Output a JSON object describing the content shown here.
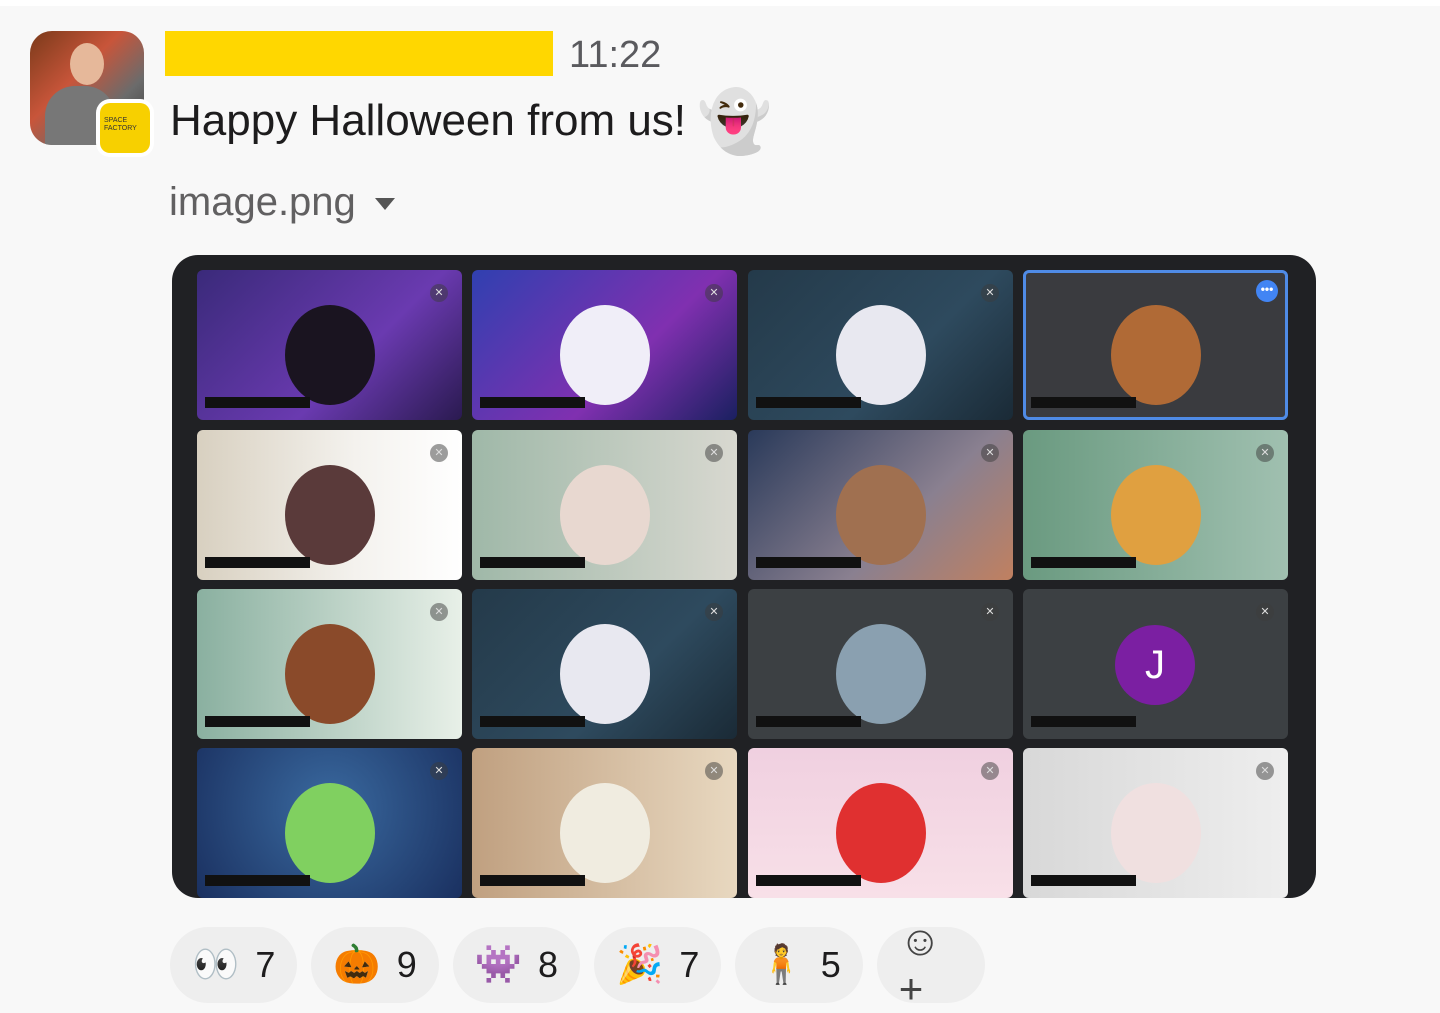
{
  "message": {
    "timestamp": "11:22",
    "text": "Happy Halloween from us!",
    "emoji": "👻",
    "badge_text": "SPACE FACTORY"
  },
  "attachment": {
    "filename": "image.png"
  },
  "video_grid": {
    "tiles": [
      {
        "bg": "linear-gradient(135deg,#3a2a7a,#6a3ab0 60%,#2a1a50)",
        "fig": "#1a1420"
      },
      {
        "bg": "linear-gradient(135deg,#3040b0,#8030b0 60%,#1a2060)",
        "fig": "#f0eef8"
      },
      {
        "bg": "linear-gradient(135deg,#243a4a,#2e4a5e 60%,#1a2a36)",
        "fig": "#e8e8f0"
      },
      {
        "bg": "#3a3b3f",
        "fig": "#b06a36",
        "selected": true
      },
      {
        "bg": "linear-gradient(90deg,#d8d0c0,#f4f2ee 60%,#fff)",
        "fig": "#5a3a3a"
      },
      {
        "bg": "linear-gradient(90deg,#9fb8a8,#d8d8d0)",
        "fig": "#e8d8d0"
      },
      {
        "bg": "linear-gradient(135deg,#2a3a5a,#8a8090 60%,#c08060)",
        "fig": "#a07050"
      },
      {
        "bg": "linear-gradient(90deg,#6a9a80,#a0c0b0)",
        "fig": "#e0a040"
      },
      {
        "bg": "linear-gradient(90deg,#8ab0a0,#e8f0e8)",
        "fig": "#8a4a2a"
      },
      {
        "bg": "linear-gradient(135deg,#243a4a,#2e4a5e 60%,#1a2a36)",
        "fig": "#e8e8f0"
      },
      {
        "bg": "#3c4043",
        "fig": "#8aa0b0"
      },
      {
        "bg": "#3c4043",
        "avatar": "J"
      },
      {
        "bg": "radial-gradient(circle at 50% 40%,#3a6aa0,#1a3060)",
        "fig": "#80d060"
      },
      {
        "bg": "linear-gradient(90deg,#c0a080,#e8d8c0)",
        "fig": "#f0ece0"
      },
      {
        "bg": "linear-gradient(180deg,#f0d0e0,#f8e0e8)",
        "fig": "#e03030"
      },
      {
        "bg": "linear-gradient(90deg,#d8d8d8,#eeeeee)",
        "fig": "#f0e0e0"
      }
    ],
    "more_icon": "•••",
    "mic_icon": "mic-off"
  },
  "reactions": [
    {
      "emoji": "👀",
      "count": "7"
    },
    {
      "emoji": "🎃",
      "count": "9"
    },
    {
      "emoji": "👾",
      "count": "8"
    },
    {
      "emoji": "🎉",
      "count": "7"
    },
    {
      "emoji": "🧍",
      "count": "5"
    }
  ],
  "add_reaction_icon": "☺+"
}
